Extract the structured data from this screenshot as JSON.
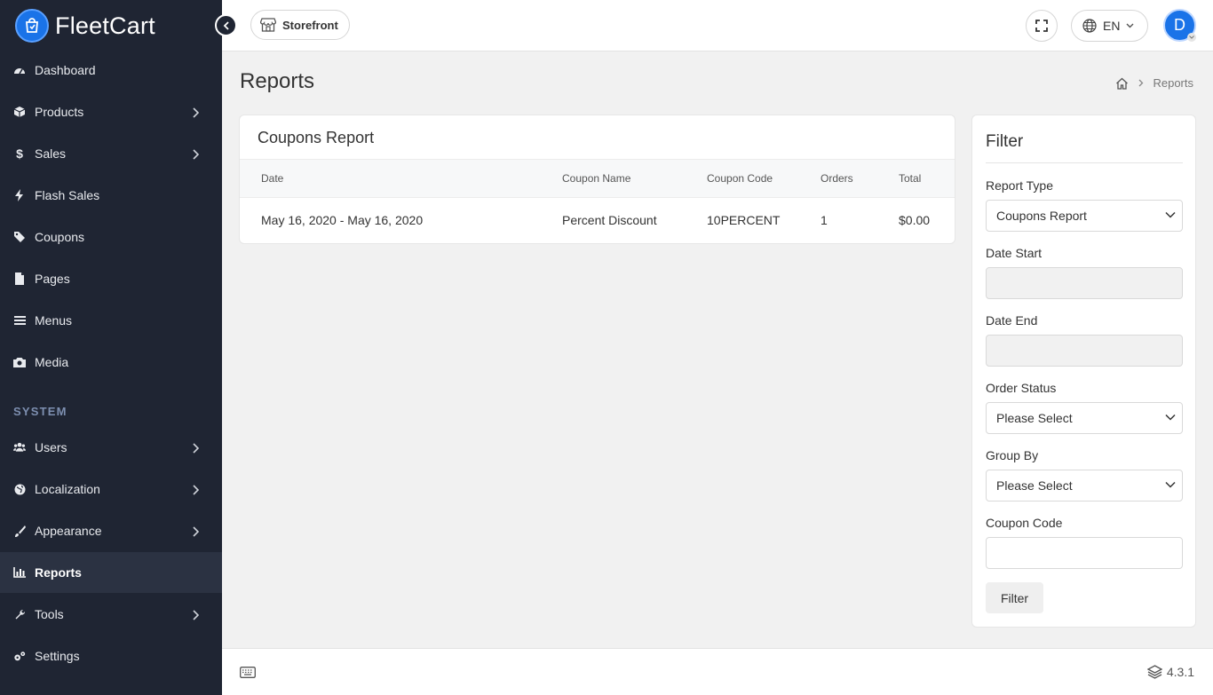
{
  "app": {
    "name": "FleetCart",
    "brand_color": "#1a73e8",
    "sidebar_bg": "#1f2533"
  },
  "sidebar": {
    "items": [
      {
        "label": "Dashboard",
        "icon": "dashboard-icon",
        "has_children": false
      },
      {
        "label": "Products",
        "icon": "box-icon",
        "has_children": true
      },
      {
        "label": "Sales",
        "icon": "dollar-icon",
        "has_children": true
      },
      {
        "label": "Flash Sales",
        "icon": "bolt-icon",
        "has_children": false
      },
      {
        "label": "Coupons",
        "icon": "tags-icon",
        "has_children": false
      },
      {
        "label": "Pages",
        "icon": "file-icon",
        "has_children": false
      },
      {
        "label": "Menus",
        "icon": "bars-icon",
        "has_children": false
      },
      {
        "label": "Media",
        "icon": "camera-icon",
        "has_children": false
      }
    ],
    "section_label": "SYSTEM",
    "system_items": [
      {
        "label": "Users",
        "icon": "users-icon",
        "has_children": true
      },
      {
        "label": "Localization",
        "icon": "globe-icon",
        "has_children": true
      },
      {
        "label": "Appearance",
        "icon": "brush-icon",
        "has_children": true
      },
      {
        "label": "Reports",
        "icon": "bar-chart-icon",
        "has_children": false,
        "active": true
      },
      {
        "label": "Tools",
        "icon": "wrench-icon",
        "has_children": true
      },
      {
        "label": "Settings",
        "icon": "cogs-icon",
        "has_children": false
      }
    ]
  },
  "header": {
    "storefront_label": "Storefront",
    "language": "EN",
    "avatar_initial": "D"
  },
  "page": {
    "title": "Reports",
    "breadcrumb": [
      "Reports"
    ]
  },
  "report": {
    "title": "Coupons Report",
    "columns": [
      "Date",
      "Coupon Name",
      "Coupon Code",
      "Orders",
      "Total"
    ],
    "rows": [
      [
        "May 16, 2020 - May 16, 2020",
        "Percent Discount",
        "10PERCENT",
        "1",
        "$0.00"
      ]
    ]
  },
  "filter": {
    "title": "Filter",
    "report_type_label": "Report Type",
    "report_type_value": "Coupons Report",
    "date_start_label": "Date Start",
    "date_start_value": "",
    "date_end_label": "Date End",
    "date_end_value": "",
    "order_status_label": "Order Status",
    "order_status_value": "Please Select",
    "group_by_label": "Group By",
    "group_by_value": "Please Select",
    "coupon_code_label": "Coupon Code",
    "coupon_code_value": "",
    "button_label": "Filter"
  },
  "footer": {
    "version": "4.3.1"
  }
}
